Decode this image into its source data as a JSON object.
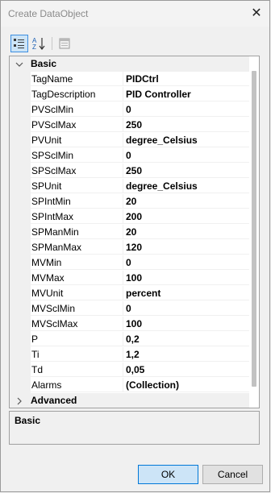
{
  "window": {
    "title": "Create DataObject",
    "close_glyph": "✕"
  },
  "toolbar": {
    "buttons": [
      {
        "icon": "categorized-icon",
        "active": true
      },
      {
        "icon": "alphabetical-sort-icon",
        "active": false
      },
      {
        "icon": "property-pages-icon",
        "active": false
      }
    ]
  },
  "grid": {
    "categories": [
      {
        "label": "Basic",
        "expanded": true,
        "properties": [
          {
            "name": "TagName",
            "value": "PIDCtrl"
          },
          {
            "name": "TagDescription",
            "value": "PID Controller"
          },
          {
            "name": "PVSclMin",
            "value": "0"
          },
          {
            "name": "PVSclMax",
            "value": "250"
          },
          {
            "name": "PVUnit",
            "value": "degree_Celsius"
          },
          {
            "name": "SPSclMin",
            "value": "0"
          },
          {
            "name": "SPSclMax",
            "value": "250"
          },
          {
            "name": "SPUnit",
            "value": "degree_Celsius"
          },
          {
            "name": "SPIntMin",
            "value": "20"
          },
          {
            "name": "SPIntMax",
            "value": "200"
          },
          {
            "name": "SPManMin",
            "value": "20"
          },
          {
            "name": "SPManMax",
            "value": "120"
          },
          {
            "name": "MVMin",
            "value": "0"
          },
          {
            "name": "MVMax",
            "value": "100"
          },
          {
            "name": "MVUnit",
            "value": "percent"
          },
          {
            "name": "MVSclMin",
            "value": "0"
          },
          {
            "name": "MVSclMax",
            "value": "100"
          },
          {
            "name": "P",
            "value": "0,2"
          },
          {
            "name": "Ti",
            "value": "1,2"
          },
          {
            "name": "Td",
            "value": "0,05"
          },
          {
            "name": "Alarms",
            "value": "(Collection)"
          }
        ]
      },
      {
        "label": "Advanced",
        "expanded": false,
        "properties": []
      }
    ]
  },
  "description": {
    "title": "Basic"
  },
  "buttons": {
    "ok_label": "OK",
    "cancel_label": "Cancel"
  },
  "colors": {
    "accent": "#0078d7",
    "selected_tool": "#cce4f7"
  }
}
